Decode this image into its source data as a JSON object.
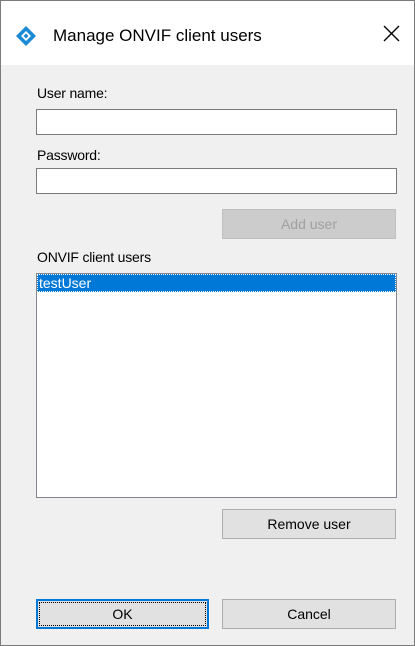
{
  "window": {
    "title": "Manage ONVIF client users",
    "icon": "diamond-app-icon",
    "close_icon": "close-icon"
  },
  "form": {
    "username_label": "User name:",
    "username_value": "",
    "password_label": "Password:",
    "password_value": "",
    "add_user_label": "Add user"
  },
  "users": {
    "list_label": "ONVIF client users",
    "items": [
      "testUser"
    ],
    "selected": "testUser",
    "remove_label": "Remove user"
  },
  "footer": {
    "ok_label": "OK",
    "cancel_label": "Cancel"
  },
  "colors": {
    "accent": "#0078d7",
    "disabled_text": "#a0a0a0"
  }
}
